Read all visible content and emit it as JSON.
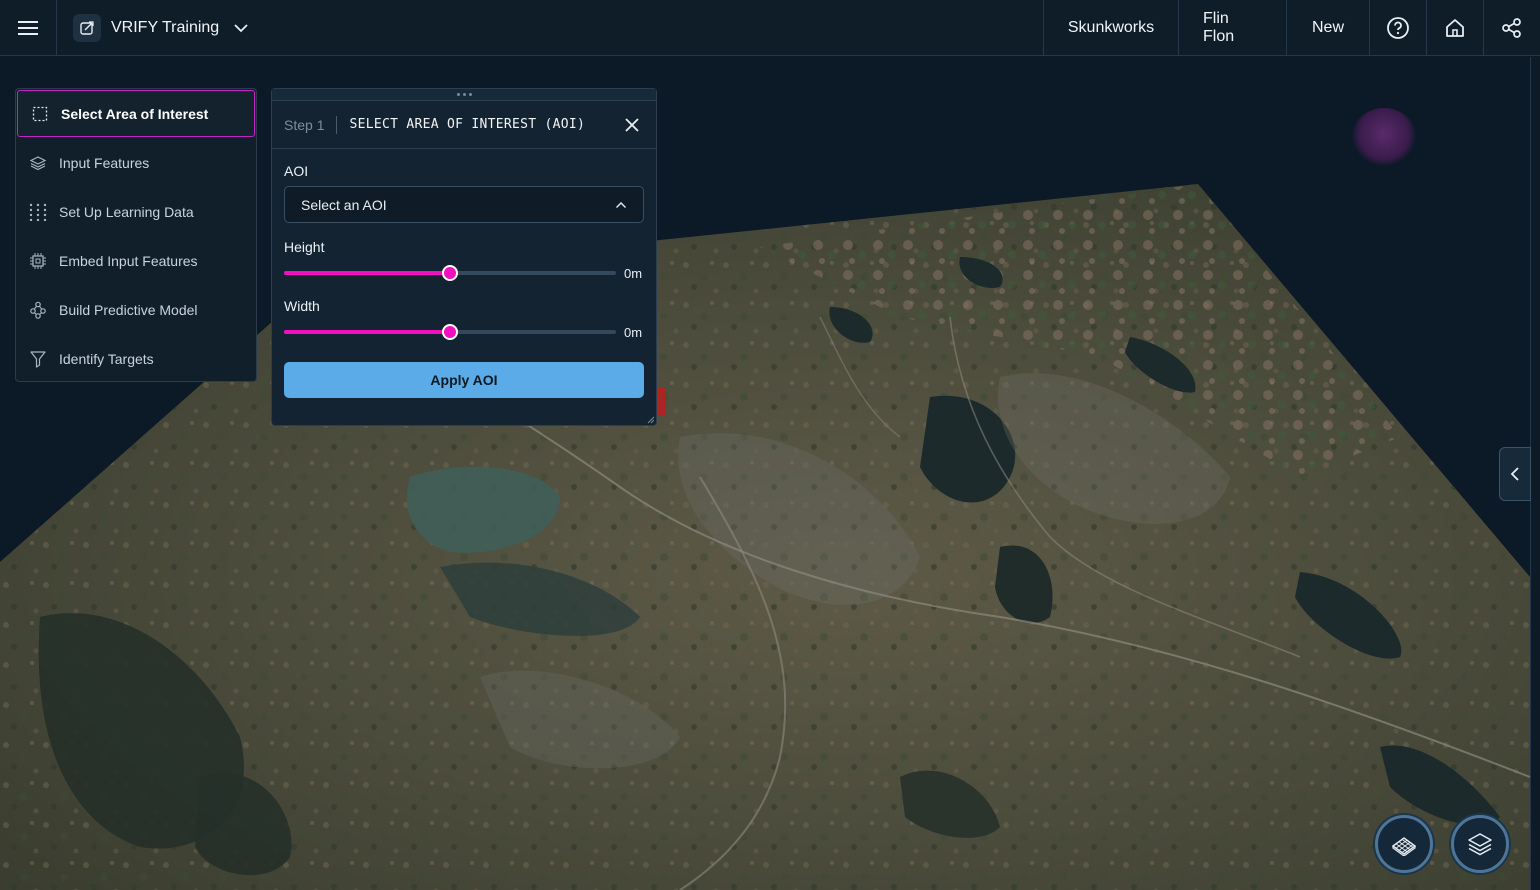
{
  "topbar": {
    "project_name": "VRIFY Training",
    "nav": [
      "Skunkworks",
      "Flin Flon",
      "New"
    ],
    "icons": [
      "help-icon",
      "home-icon",
      "share-icon"
    ]
  },
  "steps": [
    {
      "label": "Select Area of Interest",
      "icon": "select-area-icon",
      "active": true
    },
    {
      "label": "Input Features",
      "icon": "layers-icon",
      "active": false
    },
    {
      "label": "Set Up Learning Data",
      "icon": "grid-dots-icon",
      "active": false
    },
    {
      "label": "Embed Input Features",
      "icon": "chip-icon",
      "active": false
    },
    {
      "label": "Build Predictive Model",
      "icon": "model-icon",
      "active": false
    },
    {
      "label": "Identify Targets",
      "icon": "filter-icon",
      "active": false
    }
  ],
  "dialog": {
    "step_label": "Step 1",
    "title": "SELECT AREA OF INTEREST (AOI)",
    "aoi_label": "AOI",
    "aoi_value": "Select an AOI",
    "height_label": "Height",
    "height_value": "0m",
    "height_fraction": 0.5,
    "width_label": "Width",
    "width_value": "0m",
    "width_fraction": 0.5,
    "apply_label": "Apply AOI"
  },
  "colors": {
    "accent_magenta": "#f20fc0",
    "apply_blue": "#5aabe8",
    "background": "#0f1d28"
  }
}
